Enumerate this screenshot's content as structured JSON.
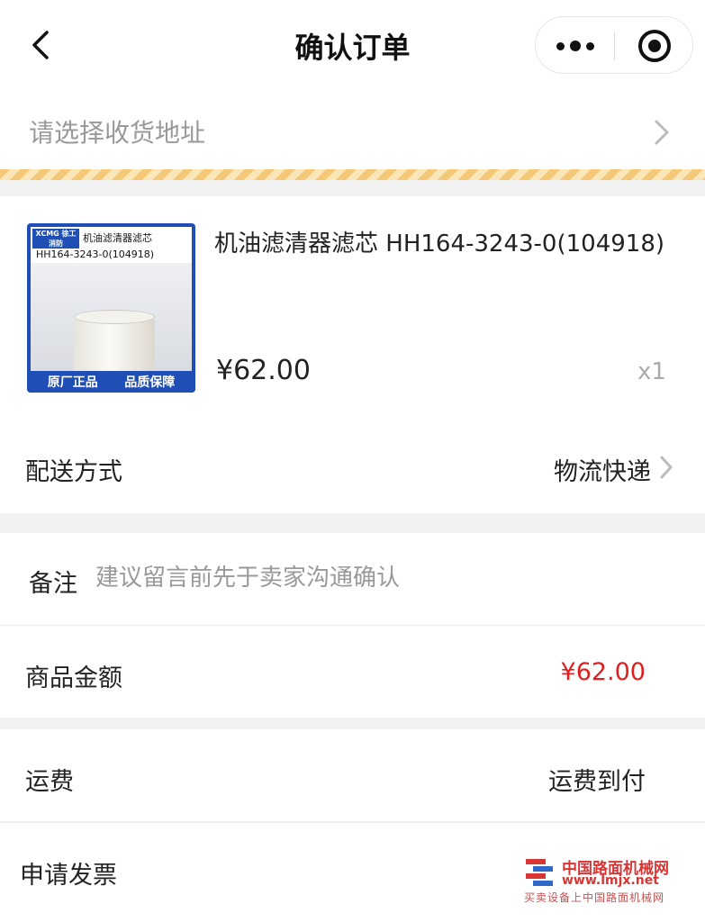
{
  "navbar": {
    "title": "确认订单",
    "back_icon": "chevron-left-icon",
    "more_icon": "more-dots-icon",
    "close_icon": "target-close-icon"
  },
  "address": {
    "placeholder": "请选择收货地址",
    "chevron_icon": "chevron-right-icon"
  },
  "product": {
    "thumbnail": {
      "logo": "XCMG 徐工消防",
      "name": "机油滤清器滤芯",
      "code": "HH164-3243-0(104918)",
      "badge_left": "原厂正品",
      "badge_right": "品质保障"
    },
    "title": "机油滤清器滤芯 HH164-3243-0(104918)",
    "price": "¥62.00",
    "quantity": "x1"
  },
  "delivery": {
    "label": "配送方式",
    "value": "物流快递"
  },
  "remark": {
    "label": "备注",
    "placeholder": "建议留言前先于卖家沟通确认",
    "value": ""
  },
  "amount": {
    "label": "商品金额",
    "value": "¥62.00",
    "value_color": "#e02020"
  },
  "shipping": {
    "label": "运费",
    "value": "运费到付"
  },
  "invoice": {
    "label": "申请发票"
  },
  "watermark": {
    "name": "中国路面机械网",
    "url": "www.lmjx.net",
    "subtitle": "买卖设备上中国路面机械网"
  }
}
